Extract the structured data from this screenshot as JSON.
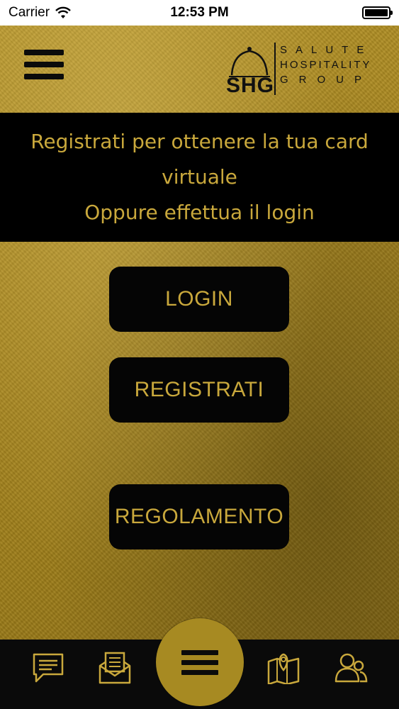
{
  "status_bar": {
    "carrier": "Carrier",
    "time": "12:53 PM",
    "battery_level": 1.0
  },
  "header": {
    "menu_icon": "hamburger-menu-icon",
    "logo": {
      "monogram": "SHG",
      "line1": "SALUTE",
      "line2": "HOSPITALITY",
      "line3": "GROUP"
    }
  },
  "banner": {
    "line1": "Registrati per ottenere la tua card",
    "line2": "virtuale",
    "line3": "Oppure effettua il login"
  },
  "buttons": {
    "login": "LOGIN",
    "register": "REGISTRATI",
    "rules": "REGOLAMENTO"
  },
  "tab_bar": {
    "items": [
      {
        "icon": "chat-icon"
      },
      {
        "icon": "mail-icon"
      },
      {
        "icon": "hamburger-menu-icon"
      },
      {
        "icon": "map-icon"
      },
      {
        "icon": "users-icon"
      }
    ]
  },
  "colors": {
    "gold": "#c9a83c",
    "black": "#000000",
    "gold_background": "#a8861e"
  }
}
